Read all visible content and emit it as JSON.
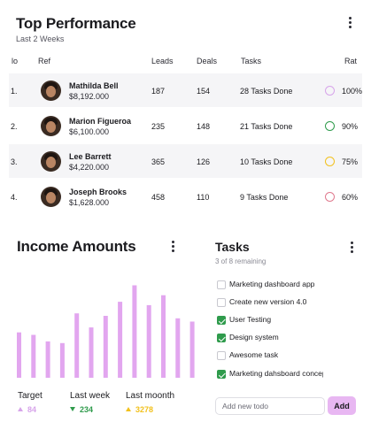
{
  "performance": {
    "title": "Top Performance",
    "subtitle": "Last 2 Weeks",
    "columns": {
      "no": "lo",
      "ref": "Ref",
      "leads": "Leads",
      "deals": "Deals",
      "tasks": "Tasks",
      "rate": "Rat"
    },
    "rows": [
      {
        "no": "1.",
        "name": "Mathilda Bell",
        "amount": "$8,192.000",
        "leads": "187",
        "deals": "154",
        "tasks": "28 Tasks Done",
        "rate": "100%",
        "rate_value": 100,
        "ring_color": "#d7a4ea"
      },
      {
        "no": "2.",
        "name": "Marion Figueroa",
        "amount": "$6,100.000",
        "leads": "235",
        "deals": "148",
        "tasks": "21 Tasks Done",
        "rate": "90%",
        "rate_value": 90,
        "ring_color": "#2f9b4c"
      },
      {
        "no": "3.",
        "name": "Lee Barrett",
        "amount": "$4,220.000",
        "leads": "365",
        "deals": "126",
        "tasks": "10 Tasks Done",
        "rate": "75%",
        "rate_value": 75,
        "ring_color": "#f2c11d"
      },
      {
        "no": "4.",
        "name": "Joseph Brooks",
        "amount": "$1,628.000",
        "leads": "458",
        "deals": "110",
        "tasks": "9 Tasks Done",
        "rate": "60%",
        "rate_value": 60,
        "ring_color": "#e07a8e"
      }
    ]
  },
  "income": {
    "title": "Income Amounts",
    "stats": [
      {
        "label": "Target",
        "value": "84",
        "trend": "up",
        "color": "#d7a4ea"
      },
      {
        "label": "Last week",
        "value": "234",
        "trend": "down",
        "color": "#2f9b4c"
      },
      {
        "label": "Last moonth",
        "value": "3278",
        "trend": "up",
        "color": "#f2c11d"
      }
    ]
  },
  "chart_data": {
    "type": "bar",
    "values": [
      55,
      52,
      44,
      42,
      78,
      61,
      75,
      92,
      112,
      88,
      100,
      72,
      68
    ],
    "ylim": [
      0,
      120
    ],
    "bar_color": "#e2a6ef",
    "grid": false
  },
  "tasks": {
    "title": "Tasks",
    "subtitle": "3 of 8 remaining",
    "items": [
      {
        "label": "Marketing dashboard app",
        "done": false
      },
      {
        "label": "Create new version 4.0",
        "done": false
      },
      {
        "label": "User Testing",
        "done": true
      },
      {
        "label": "Design system",
        "done": true
      },
      {
        "label": "Awesome task",
        "done": false
      },
      {
        "label": "Marketing dahsboard concept",
        "done": true
      }
    ],
    "input_placeholder": "Add new todo",
    "add_label": "Add"
  }
}
